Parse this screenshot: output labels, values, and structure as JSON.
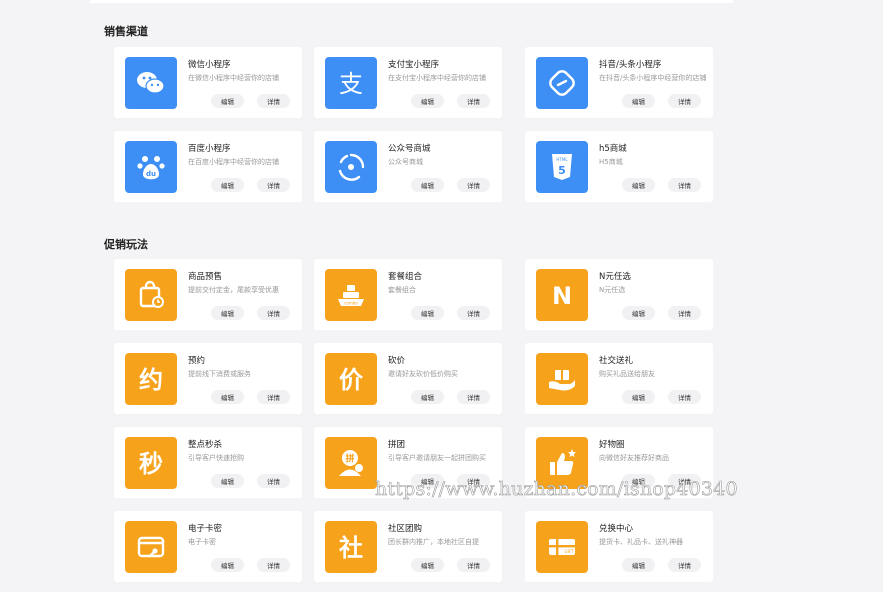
{
  "sections": [
    {
      "title": "销售渠道"
    },
    {
      "title": "促销玩法"
    }
  ],
  "buttons": {
    "edit": "编辑",
    "detail": "详情"
  },
  "colors": {
    "blue": "#3d8ff5",
    "orange": "#f7a21b",
    "background": "#f4f4f6"
  },
  "channels": [
    {
      "name": "微信小程序",
      "desc": "在微信小程序中经营你的店铺",
      "icon": "wechat-icon"
    },
    {
      "name": "支付宝小程序",
      "desc": "在支付宝小程序中经营你的店铺",
      "icon": "alipay-icon"
    },
    {
      "name": "抖音/头条小程序",
      "desc": "在抖音/头条小程序中经营你的店铺",
      "icon": "douyin-link-icon"
    },
    {
      "name": "百度小程序",
      "desc": "在百度小程序中经营你的店铺",
      "icon": "baidu-paw-icon"
    },
    {
      "name": "公众号商城",
      "desc": "公众号商城",
      "icon": "official-account-icon"
    },
    {
      "name": "h5商城",
      "desc": "H5商城",
      "icon": "html5-icon"
    }
  ],
  "promotions": [
    {
      "name": "商品预售",
      "desc": "提前交付定金，尾款享受优惠",
      "icon": "presale-bag-icon"
    },
    {
      "name": "套餐组合",
      "desc": "套餐组合",
      "icon": "combo-icon"
    },
    {
      "name": "N元任选",
      "desc": "N元任选",
      "icon": "n-letter-icon",
      "glyph": "N"
    },
    {
      "name": "预约",
      "desc": "提前线下消费或服务",
      "icon": "appointment-icon",
      "glyph": "约"
    },
    {
      "name": "砍价",
      "desc": "邀请好友砍价低价购买",
      "icon": "bargain-icon",
      "glyph": "价"
    },
    {
      "name": "社交送礼",
      "desc": "购买礼品送给朋友",
      "icon": "gift-hand-icon"
    },
    {
      "name": "整点秒杀",
      "desc": "引导客户快速抢购",
      "icon": "flash-sale-icon",
      "glyph": "秒"
    },
    {
      "name": "拼团",
      "desc": "引导客户邀请朋友一起拼团购买",
      "icon": "group-buy-icon"
    },
    {
      "name": "好物圈",
      "desc": "向微信好友推荐好商品",
      "icon": "thumbs-up-icon"
    },
    {
      "name": "电子卡密",
      "desc": "电子卡密",
      "icon": "e-card-icon"
    },
    {
      "name": "社区团购",
      "desc": "团长群内推广，本地社区自提",
      "icon": "community-bag-icon",
      "glyph": "社"
    },
    {
      "name": "兑换中心",
      "desc": "提货卡、礼品卡、送礼神器",
      "icon": "gift-card-icon"
    }
  ],
  "watermark": "https://www.huzhan.com/ishop40340"
}
